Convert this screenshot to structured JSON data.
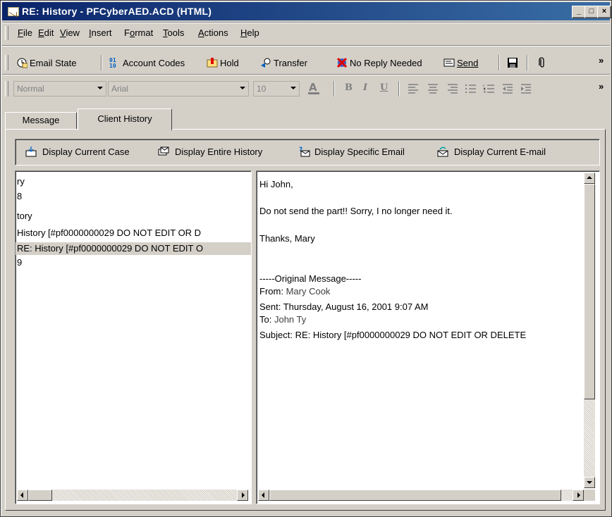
{
  "window": {
    "title": "RE: History - PFCyberAED.ACD (HTML)",
    "controls": [
      "_",
      "□",
      "×"
    ]
  },
  "menu": {
    "items": [
      "File",
      "Edit",
      "View",
      "Insert",
      "Format",
      "Tools",
      "Actions",
      "Help"
    ],
    "accelerators": [
      "F",
      "E",
      "V",
      "I",
      "o",
      "T",
      "A",
      "H"
    ]
  },
  "toolbar": {
    "email_state": "Email State",
    "account_codes": "Account Codes",
    "hold": "Hold",
    "transfer": "Transfer",
    "no_reply": "No Reply Needed",
    "send": "Send",
    "overflow": "»"
  },
  "format_toolbar": {
    "style": "Normal",
    "font": "Arial",
    "size": "10",
    "bold": "B",
    "italic": "I",
    "underline": "U",
    "overflow": "»"
  },
  "tabs": [
    {
      "label": "Message",
      "active": false
    },
    {
      "label": "Client History",
      "active": true
    }
  ],
  "history_toolbar": {
    "current_case": "Display Current Case",
    "entire_history": "Display Entire History",
    "specific_email": "Display Specific Email",
    "current_email": "Display Current E-mail"
  },
  "tree": {
    "rows": [
      {
        "text": "ry",
        "selected": false
      },
      {
        "text": "8",
        "selected": false
      },
      {
        "text": "tory",
        "selected": false
      },
      {
        "text": " History [#pf0000000029 DO NOT EDIT OR D",
        "selected": false
      },
      {
        "text": " RE: History [#pf0000000029 DO NOT EDIT O",
        "selected": true
      },
      {
        "text": "9",
        "selected": false
      }
    ]
  },
  "message": {
    "greeting": "Hi John,",
    "body": "Do not send the part!! Sorry, I no longer need it.",
    "signoff": "Thanks, Mary",
    "original_header": "-----Original Message-----",
    "from_label": "From:",
    "from_value": "Mary Cook",
    "sent": "Sent: Thursday, August 16, 2001 9:07 AM",
    "to_label": "To:",
    "to_value": "John Ty",
    "subject": "Subject: RE: History [#pf0000000029 DO NOT EDIT OR DELETE"
  },
  "colors": {
    "titlebar_start": "#0a246a",
    "titlebar_end": "#3a6ea5",
    "face": "#d4d0c8",
    "selection": "#d4d0c8"
  }
}
